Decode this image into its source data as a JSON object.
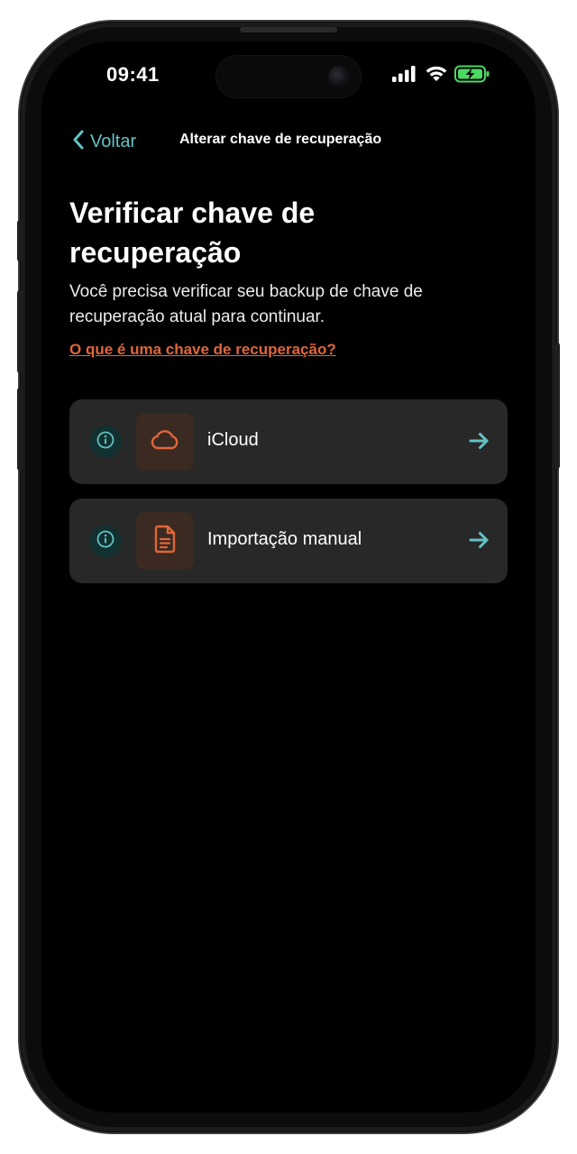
{
  "status_bar": {
    "time": "09:41",
    "icons": [
      "cellular-signal-icon",
      "wifi-icon",
      "battery-charging-icon"
    ]
  },
  "nav": {
    "back_label": "Voltar",
    "title": "Alterar chave de recuperação"
  },
  "main": {
    "heading": "Verificar chave de recuperação",
    "description": "Você precisa verificar seu backup de chave de recuperação atual para continuar.",
    "help_link": "O que é uma chave de recuperação?",
    "options": [
      {
        "label": "iCloud",
        "icon": "cloud-icon"
      },
      {
        "label": "Importação manual",
        "icon": "document-icon"
      }
    ]
  },
  "colors": {
    "background": "#000000",
    "card": "#282828",
    "accent_teal": "#63c2c4",
    "accent_orange": "#e0663a",
    "battery_green": "#4cd964"
  }
}
